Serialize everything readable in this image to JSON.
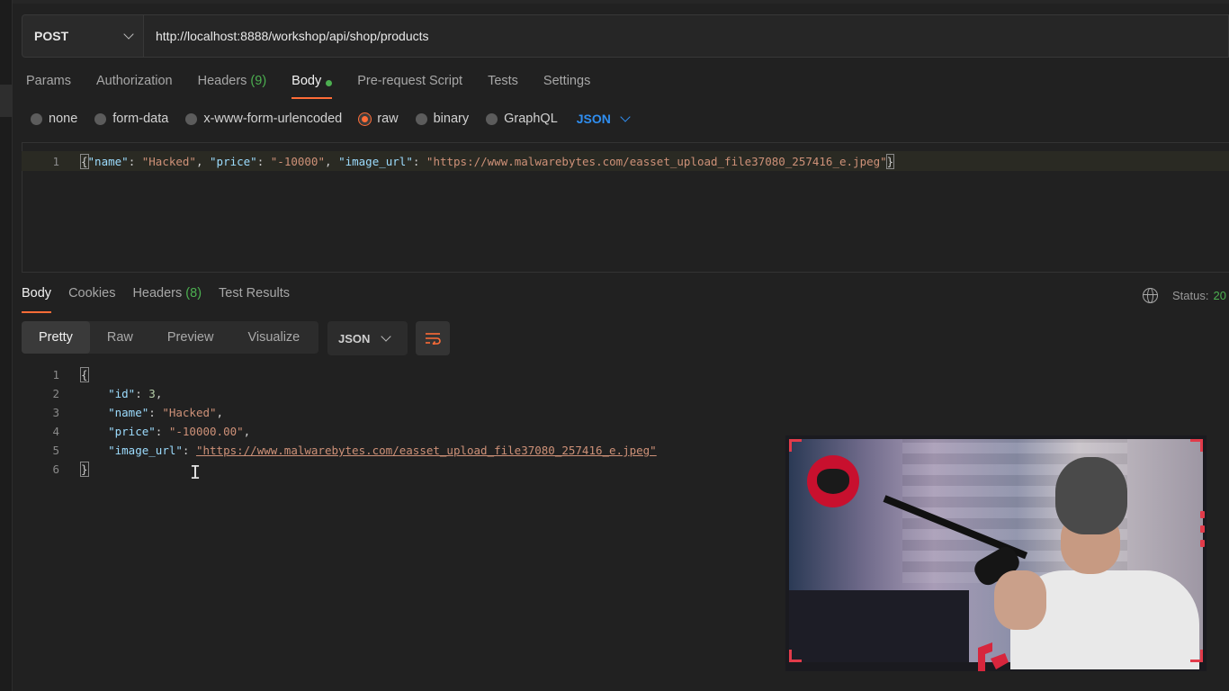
{
  "request": {
    "method": "POST",
    "url": "http://localhost:8888/workshop/api/shop/products",
    "tabs": [
      {
        "label": "Params"
      },
      {
        "label": "Authorization"
      },
      {
        "label": "Headers",
        "count": "(9)"
      },
      {
        "label": "Body"
      },
      {
        "label": "Pre-request Script"
      },
      {
        "label": "Tests"
      },
      {
        "label": "Settings"
      }
    ],
    "body_types": [
      "none",
      "form-data",
      "x-www-form-urlencoded",
      "raw",
      "binary",
      "GraphQL"
    ],
    "selected_body_type": "raw",
    "format": "JSON",
    "editor": {
      "line_number": "1",
      "k1": "\"name\"",
      "v1": "\"Hacked\"",
      "k2": "\"price\"",
      "v2": "\"-10000\"",
      "k3": "\"image_url\"",
      "v3": "\"https://www.malwarebytes.com/easset_upload_file37080_257416_e.jpeg\""
    }
  },
  "response": {
    "tabs": [
      {
        "label": "Body"
      },
      {
        "label": "Cookies"
      },
      {
        "label": "Headers",
        "count": "(8)"
      },
      {
        "label": "Test Results"
      }
    ],
    "status_label": "Status:",
    "status_code": "20",
    "view_tabs": [
      "Pretty",
      "Raw",
      "Preview",
      "Visualize"
    ],
    "format": "JSON",
    "lines": {
      "l2_key": "\"id\"",
      "l2_val": "3",
      "l3_key": "\"name\"",
      "l3_val": "\"Hacked\"",
      "l4_key": "\"price\"",
      "l4_val": "\"-10000.00\"",
      "l5_key": "\"image_url\"",
      "l5_val": "\"https://www.malwarebytes.com/easset_upload_file37080_257416_e.jpeg\""
    },
    "line_numbers": [
      "1",
      "2",
      "3",
      "4",
      "5",
      "6"
    ]
  },
  "colors": {
    "accent": "#ff6c37",
    "success": "#4caf50",
    "link_blue": "#2f8ef0",
    "background": "#212121"
  },
  "icons": [
    "chevron-down-icon",
    "globe-icon",
    "wrap-lines-icon",
    "text-cursor-icon"
  ]
}
